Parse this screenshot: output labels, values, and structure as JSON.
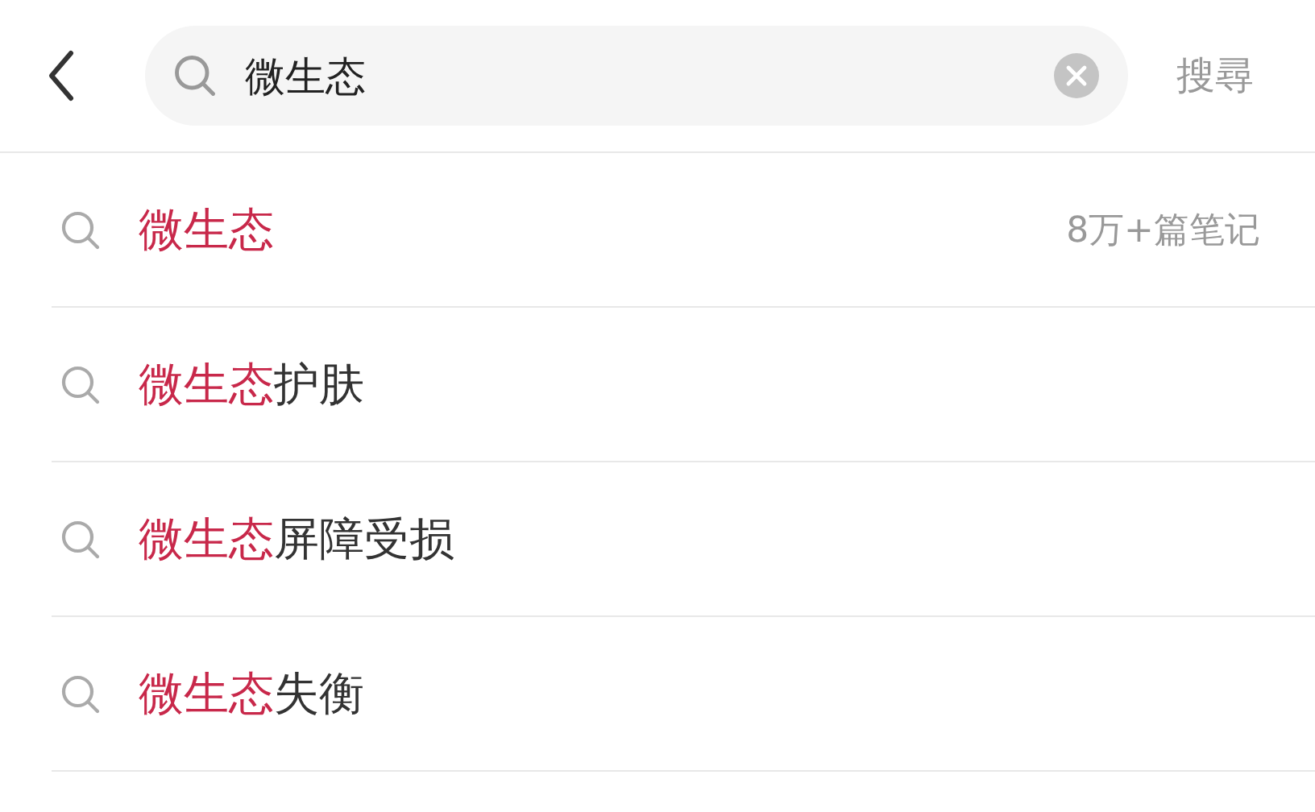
{
  "search_bar": {
    "value": "微生态",
    "submit": "搜尋"
  },
  "suggestions": [
    {
      "match": "微生态",
      "count": "8万+篇笔记"
    },
    {
      "match": "微生态",
      "rest": "护肤"
    },
    {
      "match": "微生态",
      "rest": "屏障受损"
    },
    {
      "match": "微生态",
      "rest": "失衡"
    }
  ]
}
